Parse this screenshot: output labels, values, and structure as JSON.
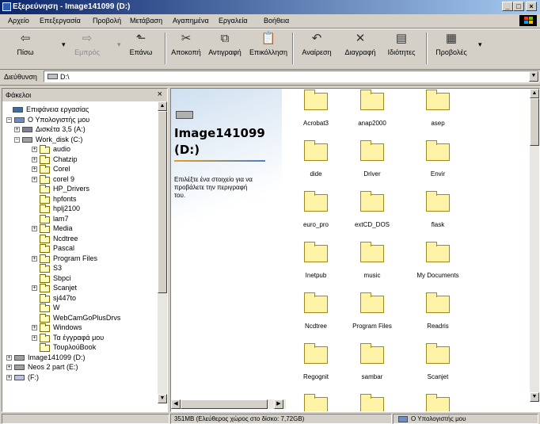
{
  "window": {
    "title": "Εξερεύνηση - Image141099 (D:)"
  },
  "menu": [
    "Αρχείο",
    "Επεξεργασία",
    "Προβολή",
    "Μετάβαση",
    "Αγαπημένα",
    "Εργαλεία",
    "Βοήθεια"
  ],
  "toolbar": {
    "back": "Πίσω",
    "forward": "Εμπρός",
    "up": "Επάνω",
    "cut": "Αποκοπή",
    "copy": "Αντιγραφή",
    "paste": "Επικόλληση",
    "undo": "Αναίρεση",
    "delete": "Διαγραφή",
    "properties": "Ιδιότητες",
    "views": "Προβολές"
  },
  "address": {
    "label": "Διεύθυνση",
    "value": "D:\\"
  },
  "folders_pane": {
    "title": "Φάκελοι",
    "close": "×",
    "tree": [
      "Επιφάνεια εργασίας",
      "Ο Υπολογιστής μου",
      "Δισκέτα 3,5 (A:)",
      "Work_disk (C:)",
      "audio",
      "Chatzip",
      "Corel",
      "corel 9",
      "HP_Drivers",
      "hpfonts",
      "hplj2100",
      "lam7",
      "Media",
      "Ncdtree",
      "Pascal",
      "Program Files",
      "S3",
      "Sbpci",
      "Scanjet",
      "sj447to",
      "W",
      "WebCamGoPlusDrvs",
      "Windows",
      "Τα έγγραφά μου",
      "ΤουρλούBook",
      "Image141099 (D:)",
      "Neos 2 part (E:)",
      "(F:)"
    ]
  },
  "webview": {
    "title": "Image141099 (D:)",
    "hint": "Επιλέξτε ένα στοιχείο για να προβάλετε την περιγραφή του."
  },
  "folders": [
    "Acrobat3",
    "anap2000",
    "asep",
    "dide",
    "Driver",
    "Envir",
    "euro_pro",
    "extCD_DOS",
    "flask",
    "Inetpub",
    "music",
    "My Documents",
    "Ncdtree",
    "Program Files",
    "Readris",
    "Regognit",
    "sambar",
    "Scanjet",
    "",
    "",
    ""
  ],
  "status": {
    "free_space": "351MB (Ελεύθερος χώρος στο δίσκο: 7,72GB)",
    "zone": "Ο Υπολογιστής μου"
  },
  "colors": {
    "titlebar": "#0a246a",
    "selection": "#0a246a",
    "face": "#d4d0c8"
  }
}
